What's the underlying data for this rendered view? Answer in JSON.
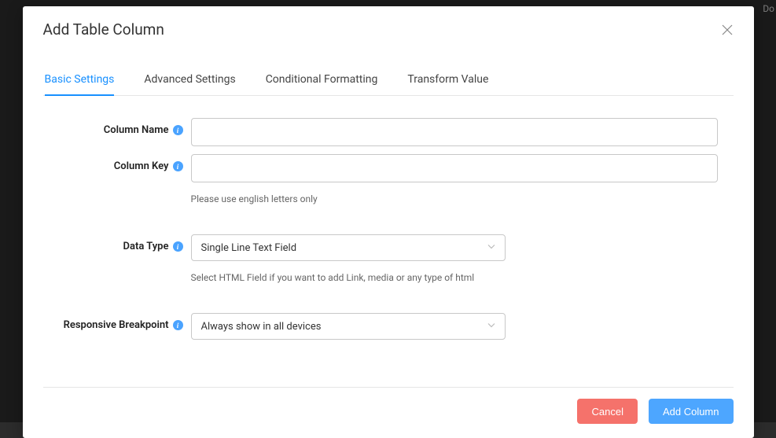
{
  "modal": {
    "title": "Add Table Column"
  },
  "tabs": {
    "items": [
      {
        "label": "Basic Settings"
      },
      {
        "label": "Advanced Settings"
      },
      {
        "label": "Conditional Formatting"
      },
      {
        "label": "Transform Value"
      }
    ]
  },
  "form": {
    "columnName": {
      "label": "Column Name",
      "value": ""
    },
    "columnKey": {
      "label": "Column Key",
      "value": "",
      "helper": "Please use english letters only"
    },
    "dataType": {
      "label": "Data Type",
      "value": "Single Line Text Field",
      "helper": "Select HTML Field if you want to add Link, media or any type of html"
    },
    "breakpoint": {
      "label": "Responsive Breakpoint",
      "value": "Always show in all devices"
    }
  },
  "footer": {
    "cancel": "Cancel",
    "submit": "Add Column"
  },
  "bgHint": "Do"
}
